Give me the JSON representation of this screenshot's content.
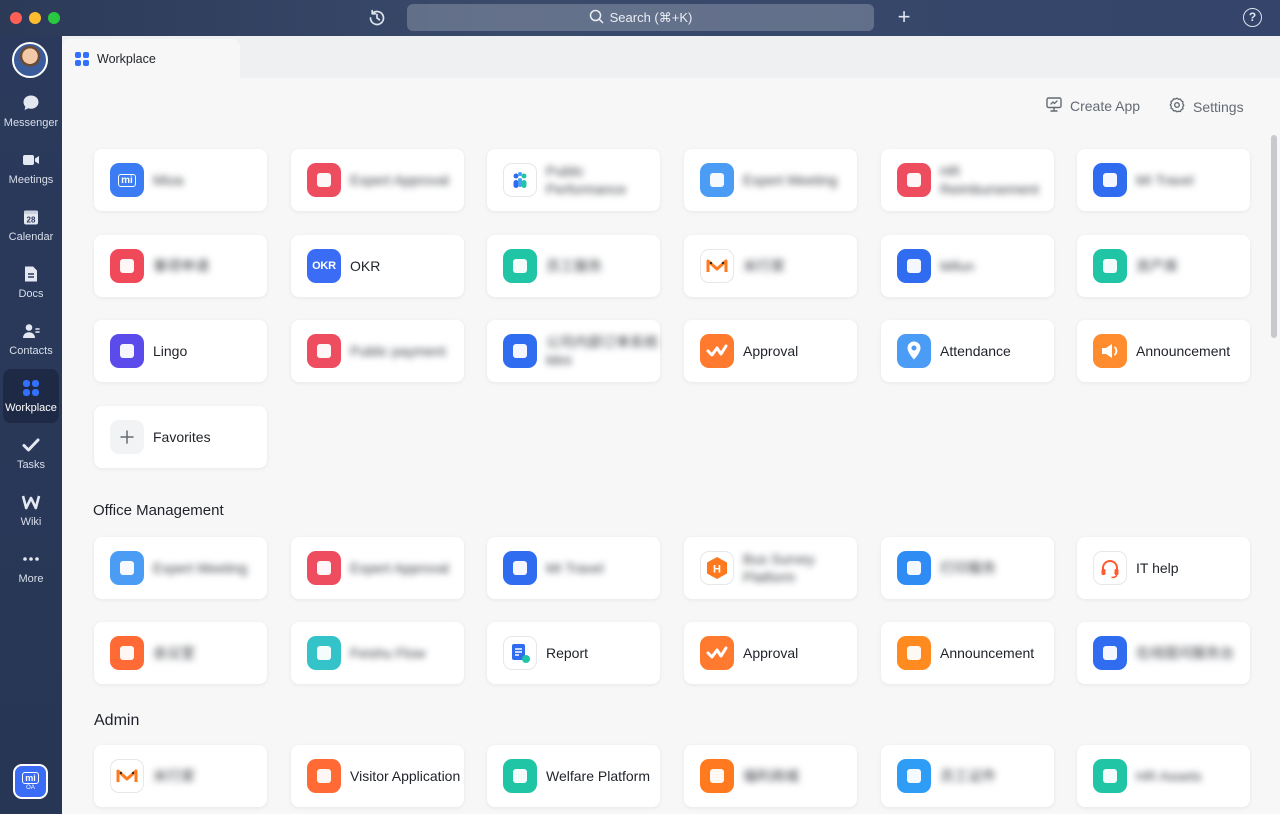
{
  "window": {
    "search_placeholder": "Search (⌘+K)",
    "plus_label": "+",
    "help_label": "?"
  },
  "sidebar": {
    "items": [
      {
        "label": "Messenger",
        "icon": "chat-bubble-icon"
      },
      {
        "label": "Meetings",
        "icon": "video-camera-icon"
      },
      {
        "label": "Calendar",
        "icon": "calendar-icon",
        "badge": "28"
      },
      {
        "label": "Docs",
        "icon": "docs-icon"
      },
      {
        "label": "Contacts",
        "icon": "contacts-icon"
      },
      {
        "label": "Workplace",
        "icon": "workplace-grid-icon",
        "active": true
      },
      {
        "label": "Tasks",
        "icon": "checkmark-icon"
      },
      {
        "label": "Wiki",
        "icon": "wiki-icon"
      },
      {
        "label": "More",
        "icon": "more-dots-icon"
      }
    ],
    "bottom_app": {
      "top": "mi",
      "bottom": "OA"
    }
  },
  "tab": {
    "label": "Workplace"
  },
  "actions": {
    "create_app": "Create App",
    "settings": "Settings"
  },
  "favorites": {
    "rows": [
      [
        {
          "name": "Mioa",
          "color": "#3b7cf5",
          "blur": true,
          "glyph": "mi"
        },
        {
          "name": "Expert Approval",
          "color": "#ee4d5f",
          "blur": true
        },
        {
          "name": "Public Performance",
          "color": "#ffffff",
          "blur": true,
          "glyph": "people"
        },
        {
          "name": "Expert Meeting",
          "color": "#4a9cf5",
          "blur": true
        },
        {
          "name": "HR Reimbursement",
          "color": "#ee4d5f",
          "blur": true
        },
        {
          "name": "MI Travel",
          "color": "#2f6cf0",
          "blur": true
        }
      ],
      [
        {
          "name": "事项申请",
          "color": "#f04a5a",
          "blur": true
        },
        {
          "name": "OKR",
          "color": "#3b6cf5",
          "blur": false,
          "glyph": "OKR"
        },
        {
          "name": "员工服务",
          "color": "#20c5a6",
          "blur": true
        },
        {
          "name": "米行家",
          "color": "#ffffff",
          "blur": true,
          "glyph": "m"
        },
        {
          "name": "Mifun",
          "color": "#2f6cf0",
          "blur": true
        },
        {
          "name": "资产库",
          "color": "#20c5a6",
          "blur": true
        }
      ],
      [
        {
          "name": "Lingo",
          "color": "#5a4bea",
          "blur": false
        },
        {
          "name": "Public payment",
          "color": "#ee4d5f",
          "blur": true
        },
        {
          "name": "公司内部订单系统 Mini",
          "color": "#2f6cf0",
          "blur": true
        },
        {
          "name": "Approval",
          "color": "#ff7a2f",
          "blur": false,
          "glyph": "check"
        },
        {
          "name": "Attendance",
          "color": "#4a9cf5",
          "blur": false,
          "glyph": "pin"
        },
        {
          "name": "Announcement",
          "color": "#ff8c2f",
          "blur": false,
          "glyph": "speaker"
        }
      ]
    ],
    "add_label": "Favorites"
  },
  "sections": [
    {
      "title": "Office Management",
      "rows": [
        [
          {
            "name": "Expert Meeting",
            "color": "#4a9cf5",
            "blur": true
          },
          {
            "name": "Expert Approval",
            "color": "#ee4d5f",
            "blur": true
          },
          {
            "name": "MI Travel",
            "color": "#2f6cf0",
            "blur": true
          },
          {
            "name": "Bus Survey Platform",
            "color": "#ffffff",
            "blur": true,
            "glyph": "hex"
          },
          {
            "name": "打印服务",
            "color": "#2f8cf5",
            "blur": true
          },
          {
            "name": "IT help",
            "color": "#ffffff",
            "blur": false,
            "glyph": "headset"
          }
        ],
        [
          {
            "name": "会议室",
            "color": "#ff6a35",
            "blur": true
          },
          {
            "name": "Feishu Flow",
            "color": "#33c3c9",
            "blur": true
          },
          {
            "name": "Report",
            "color": "#ffffff",
            "blur": false,
            "glyph": "report"
          },
          {
            "name": "Approval",
            "color": "#ff7a2f",
            "blur": false,
            "glyph": "check"
          },
          {
            "name": "Announcement",
            "color": "#ff8a1f",
            "blur": false
          },
          {
            "name": "在线提问服务台",
            "color": "#2f6cf0",
            "blur": true
          }
        ]
      ]
    },
    {
      "title": "Admin",
      "rows": [
        [
          {
            "name": "米行家",
            "color": "#ffffff",
            "blur": true,
            "glyph": "m"
          },
          {
            "name": "Visitor Application",
            "color": "#ff6a35",
            "blur": false
          },
          {
            "name": "Welfare Platform",
            "color": "#20c5a6",
            "blur": false
          },
          {
            "name": "福利商城",
            "color": "#ff7a1f",
            "blur": true
          },
          {
            "name": "员工证件",
            "color": "#2f9cf5",
            "blur": true
          },
          {
            "name": "HR Assets",
            "color": "#20c5a6",
            "blur": true
          }
        ]
      ]
    }
  ]
}
